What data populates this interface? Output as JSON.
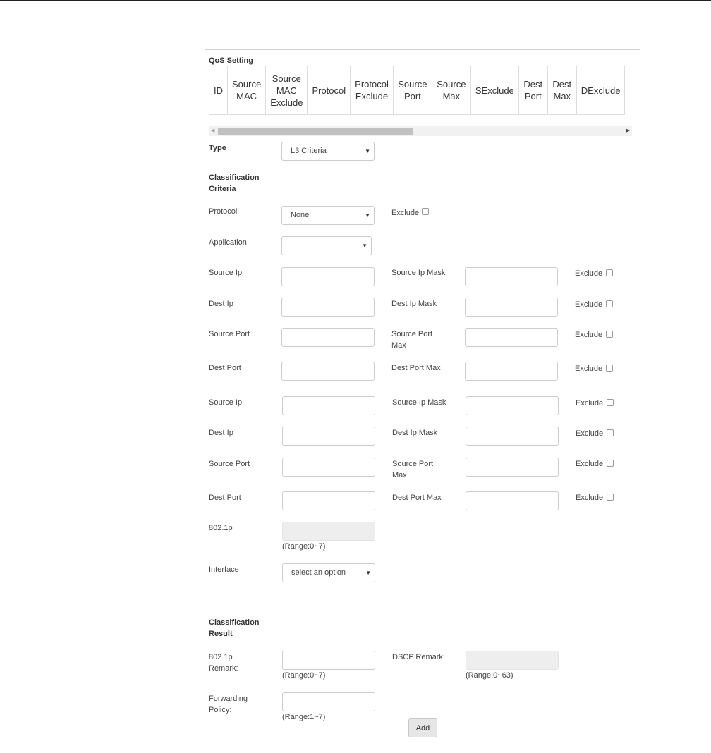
{
  "section": {
    "title": "QoS Setting"
  },
  "table": {
    "columns": [
      "ID",
      "Source MAC",
      "Source MAC Exclude",
      "Protocol",
      "Protocol Exclude",
      "Source Port",
      "Source Max",
      "SExclude",
      "Dest Port",
      "Dest Max",
      "DExclude"
    ]
  },
  "type": {
    "label": "Type",
    "value": "L3 Criteria"
  },
  "criteria": {
    "title": "Classification Criteria",
    "protocol": {
      "label": "Protocol",
      "value": "None",
      "exclude_label": "Exclude"
    },
    "application": {
      "label": "Application",
      "value": ""
    },
    "exclude_label": "Exclude",
    "group1": {
      "source_ip": "Source Ip",
      "source_ip_mask": "Source Ip Mask",
      "dest_ip": "Dest Ip",
      "dest_ip_mask": "Dest Ip Mask",
      "source_port": "Source Port",
      "source_port_max": "Source Port Max",
      "dest_port": "Dest Port",
      "dest_port_max": "Dest Port Max"
    },
    "group2": {
      "source_ip": "Source Ip",
      "source_ip_mask": "Source Ip Mask",
      "dest_ip": "Dest Ip",
      "dest_ip_mask": "Dest Ip Mask",
      "source_port": "Source Port",
      "source_port_max": "Source Port Max",
      "dest_port": "Dest Port",
      "dest_port_max": "Dest Port Max"
    },
    "p8021": {
      "label": "802.1p",
      "range": "(Range:0~7)"
    },
    "interface": {
      "label": "Interface",
      "value": "select an option"
    }
  },
  "result": {
    "title": "Classification Result",
    "remark_8021p": {
      "label": "802.1p Remark:",
      "range": "(Range:0~7)"
    },
    "dscp_remark": {
      "label": "DSCP Remark:",
      "range": "(Range:0~63)"
    },
    "forwarding_policy": {
      "label": "Forwarding Policy:",
      "range": "(Range:1~7)"
    }
  },
  "buttons": {
    "add": "Add"
  }
}
